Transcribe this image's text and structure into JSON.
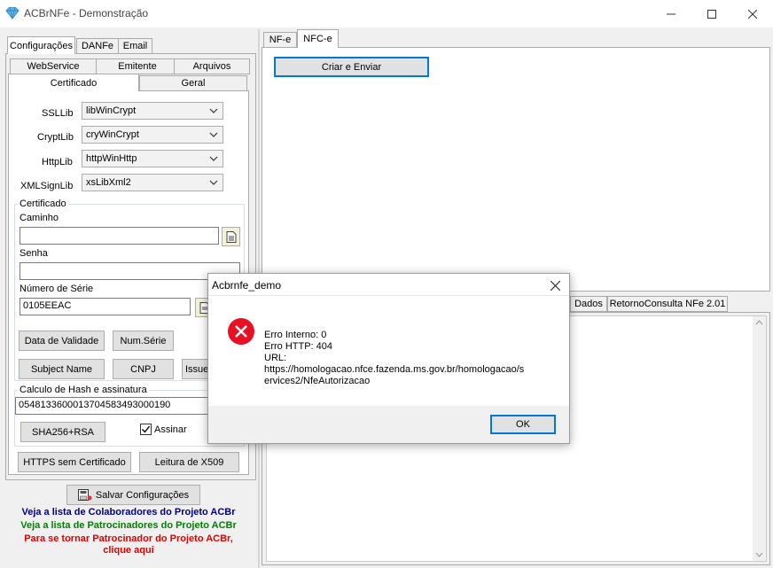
{
  "window": {
    "title": "ACBrNFe - Demonstração"
  },
  "left_tabs": [
    "Configurações",
    "DANFe",
    "Email"
  ],
  "sub_tabs_row1": [
    "WebService",
    "Emitente",
    "Arquivos"
  ],
  "sub_tabs_row2": [
    "Certificado",
    "Geral"
  ],
  "config": {
    "ssllib_label": "SSLLib",
    "ssllib_value": "libWinCrypt",
    "cryptlib_label": "CryptLib",
    "cryptlib_value": "cryWinCrypt",
    "httplib_label": "HttpLib",
    "httplib_value": "httpWinHttp",
    "xmlsignlib_label": "XMLSignLib",
    "xmlsignlib_value": "xsLibXml2"
  },
  "certificado": {
    "group_title": "Certificado",
    "caminho_label": "Caminho",
    "caminho_value": "",
    "senha_label": "Senha",
    "senha_value": "",
    "numero_serie_label": "Número de Série",
    "numero_serie_value": "0105EEAC",
    "data_validade_btn": "Data de Validade",
    "num_serie_btn": "Num.Série",
    "subject_name_btn": "Subject Name",
    "cnpj_btn": "CNPJ",
    "issuer_btn": "Issue"
  },
  "hash": {
    "group_title": "Calculo de Hash e assinatura",
    "value": "05481336000137045834930001",
    "value_tail": "90",
    "sha_btn": "SHA256+RSA",
    "assinar_label": "Assinar",
    "assinar_checked": true
  },
  "bottom_buttons": {
    "https_btn": "HTTPS sem Certificado",
    "leitura_btn": "Leitura de X509",
    "salvar_btn": "Salvar Configurações"
  },
  "links": {
    "colaboradores": "Veja a lista de Colaboradores do Projeto ACBr",
    "patrocinadores": "Veja a lista de Patrocinadores do Projeto ACBr",
    "patrocinador_line1": "Para se tornar Patrocinador do Projeto ACBr,",
    "patrocinador_line2": "clique aqui"
  },
  "right_tabs": [
    "NF-e",
    "NFC-e"
  ],
  "criar_enviar_btn": "Criar e Enviar",
  "lower_tabs": [
    "Dados",
    "RetornoConsulta NFe 2.01"
  ],
  "dialog": {
    "title": "Acbrnfe_demo",
    "line1": "Erro Interno: 0",
    "line2": "Erro HTTP: 404",
    "line3": "URL:",
    "line4": "https://homologacao.nfce.fazenda.ms.gov.br/homologacao/s",
    "line5": "ervices2/NfeAutorizacao",
    "ok_btn": "OK"
  },
  "colors": {
    "link_blue": "#00007f",
    "link_green": "#007f00",
    "link_red": "#e00000",
    "error_red": "#e81123",
    "accent": "#0078d7"
  }
}
